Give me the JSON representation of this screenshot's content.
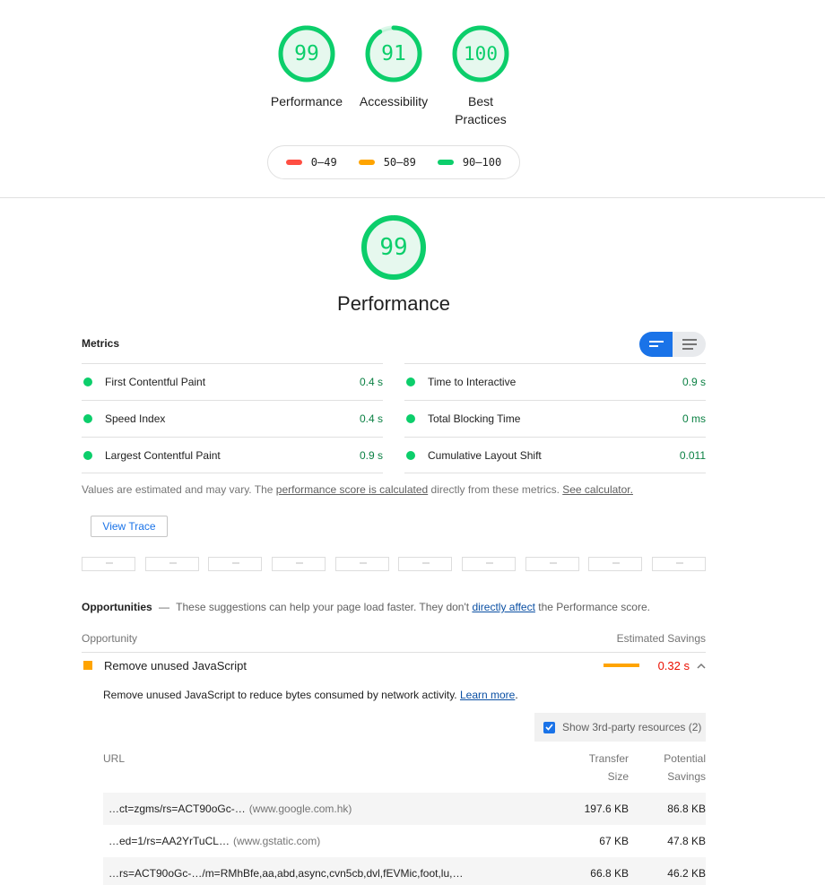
{
  "colors": {
    "pass": "#0cce6b",
    "average": "#ffa400",
    "fail": "#ff4e42",
    "accent": "#1a73e8"
  },
  "top_gauges": [
    {
      "score": "99",
      "score_value": 99,
      "label": "Performance"
    },
    {
      "score": "91",
      "score_value": 91,
      "label": "Accessibility"
    },
    {
      "score": "100",
      "score_value": 100,
      "label_line1": "Best",
      "label_line2": "Practices"
    }
  ],
  "legend": {
    "fail": "0–49",
    "average": "50–89",
    "pass": "90–100"
  },
  "main_gauge": {
    "score": "99",
    "score_value": 99,
    "title": "Performance"
  },
  "metrics": {
    "title": "Metrics",
    "left": [
      {
        "name": "First Contentful Paint",
        "value": "0.4 s"
      },
      {
        "name": "Speed Index",
        "value": "0.4 s"
      },
      {
        "name": "Largest Contentful Paint",
        "value": "0.9 s"
      }
    ],
    "right": [
      {
        "name": "Time to Interactive",
        "value": "0.9 s"
      },
      {
        "name": "Total Blocking Time",
        "value": "0 ms"
      },
      {
        "name": "Cumulative Layout Shift",
        "value": "0.011"
      }
    ],
    "note_prefix": "Values are estimated and may vary. The ",
    "note_link": "performance score is calculated",
    "note_middle": " directly from these metrics.",
    "note_link2": "See calculator.",
    "view_trace": "View Trace"
  },
  "opportunities": {
    "title": "Opportunities",
    "dash": "—",
    "desc_prefix": "These suggestions can help your page load faster. They don't ",
    "desc_link": "directly affect",
    "desc_suffix": " the Performance score.",
    "col_opportunity": "Opportunity",
    "col_savings": "Estimated Savings",
    "audit": {
      "title": "Remove unused JavaScript",
      "savings": "0.32 s",
      "description": "Remove unused JavaScript to reduce bytes consumed by network activity. ",
      "learn_more": "Learn more",
      "learn_more_suffix": ".",
      "third_party_label": "Show 3rd-party resources (2)",
      "table": {
        "col_url": "URL",
        "col_transfer_1": "Transfer",
        "col_transfer_2": "Size",
        "col_potential_1": "Potential",
        "col_potential_2": "Savings",
        "rows": [
          {
            "url": "…ct=zgms/rs=ACT90oGc-…",
            "host": "(www.google.com.hk)",
            "transfer": "197.6 KB",
            "savings": "86.8 KB"
          },
          {
            "url": "…ed=1/rs=AA2YrTuCL…",
            "host": "(www.gstatic.com)",
            "transfer": "67 KB",
            "savings": "47.8 KB"
          },
          {
            "url": "…rs=ACT90oGc-…/m=RMhBfe,aa,abd,async,cvn5cb,dvl,fEVMic,foot,lu,…",
            "host": "",
            "transfer": "66.8 KB",
            "savings": "46.2 KB"
          }
        ]
      }
    }
  }
}
